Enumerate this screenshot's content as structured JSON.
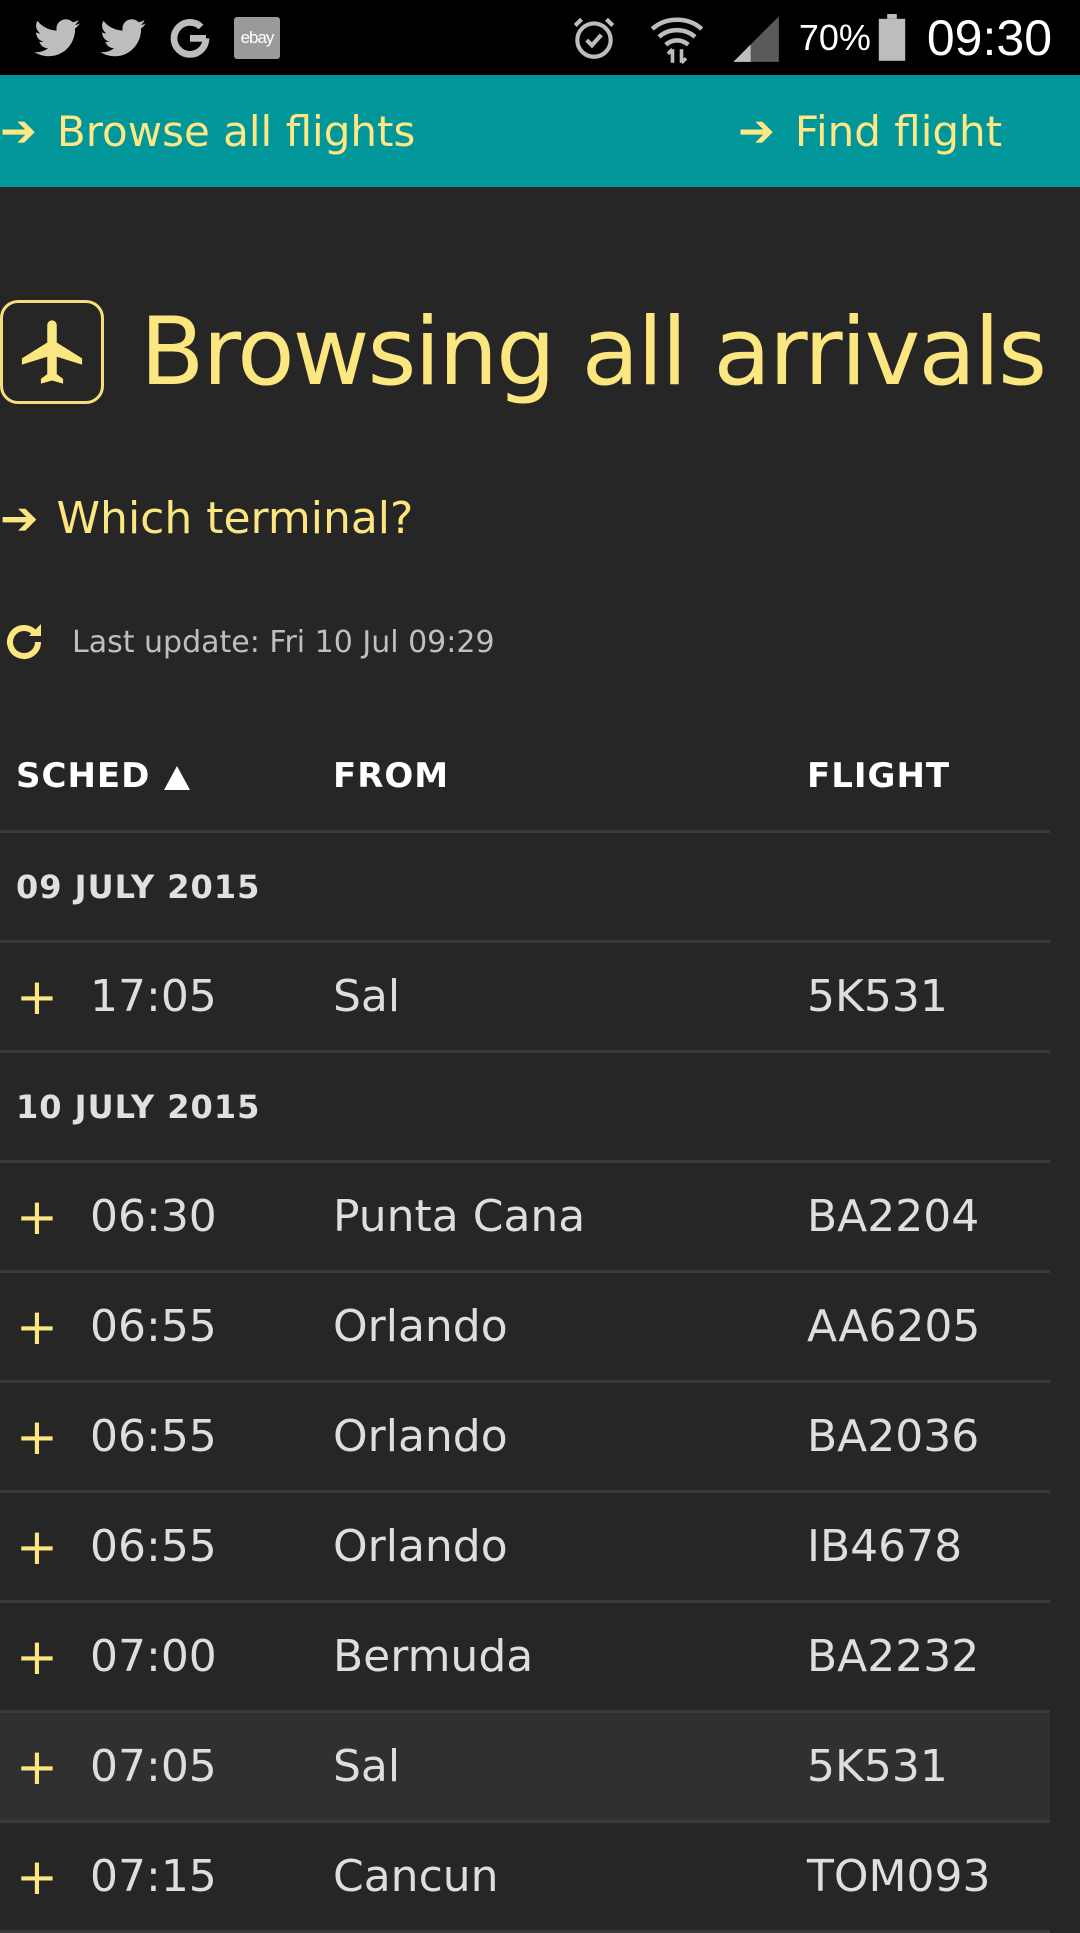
{
  "status_bar": {
    "notification_icons": [
      "twitter-icon",
      "twitter-icon",
      "google-icon",
      "ebay-icon"
    ],
    "ebay_label": "ebay",
    "battery_percent": "70%",
    "time": "09:30"
  },
  "nav": {
    "browse_label": "Browse all flights",
    "find_label": "Find flight",
    "arrow": "➔"
  },
  "page": {
    "title": "Browsing all arrivals",
    "terminal_link": "Which terminal?",
    "last_update": "Last update: Fri 10 Jul 09:29"
  },
  "table": {
    "headers": {
      "sched": "SCHED",
      "from": "FROM",
      "flight": "FLIGHT"
    },
    "groups": [
      {
        "date": "09 JULY 2015",
        "rows": [
          {
            "time": "17:05",
            "from": "Sal",
            "flight": "5K531"
          }
        ]
      },
      {
        "date": "10 JULY 2015",
        "rows": [
          {
            "time": "06:30",
            "from": "Punta Cana",
            "flight": "BA2204"
          },
          {
            "time": "06:55",
            "from": "Orlando",
            "flight": "AA6205"
          },
          {
            "time": "06:55",
            "from": "Orlando",
            "flight": "BA2036"
          },
          {
            "time": "06:55",
            "from": "Orlando",
            "flight": "IB4678"
          },
          {
            "time": "07:00",
            "from": "Bermuda",
            "flight": "BA2232"
          },
          {
            "time": "07:05",
            "from": "Sal",
            "flight": "5K531",
            "highlighted": true
          },
          {
            "time": "07:15",
            "from": "Cancun",
            "flight": "TOM093"
          }
        ]
      }
    ],
    "expand_symbol": "+"
  },
  "colors": {
    "background": "#262626",
    "nav_bar": "#00969a",
    "accent_yellow": "#fbe67f",
    "divider": "#3a3a3a"
  }
}
